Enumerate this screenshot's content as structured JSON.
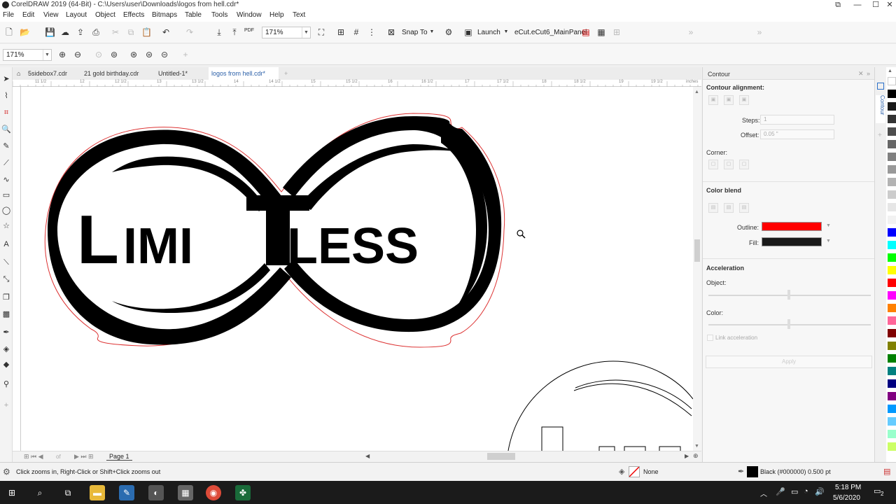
{
  "window": {
    "title": "CorelDRAW 2019 (64-Bit) - C:\\Users\\user\\Downloads\\logos from hell.cdr*"
  },
  "menu": [
    "File",
    "Edit",
    "View",
    "Layout",
    "Object",
    "Effects",
    "Bitmaps",
    "Table",
    "Tools",
    "Window",
    "Help",
    "Text"
  ],
  "toolbar": {
    "zoom_value": "171%",
    "snap_label": "Snap To",
    "launch_label": "Launch",
    "panel_label": "eCut.eCut6_MainPanel",
    "pdf_label": "PDF"
  },
  "property_bar": {
    "zoom_value": "171%"
  },
  "document_tabs": [
    "5sidebox7.cdr",
    "21 gold birthday.cdr",
    "Untitled-1*",
    "logos from hell.cdr*"
  ],
  "ruler": {
    "labels": [
      "11 1/2",
      "12",
      "12 1/2",
      "13",
      "13 1/2",
      "14",
      "14 1/2",
      "15",
      "15 1/2",
      "16",
      "16 1/2",
      "17",
      "17 1/2",
      "18",
      "18 1/2",
      "19",
      "19 1/2"
    ],
    "unit": "inches"
  },
  "canvas": {
    "logo_text": "LimiTless"
  },
  "page_nav": {
    "of_label": "of",
    "page_tab": "Page 1"
  },
  "contour_panel": {
    "title": "Contour",
    "alignment_label": "Contour alignment:",
    "steps_label": "Steps:",
    "steps_value": "1",
    "offset_label": "Offset:",
    "offset_value": "0.05 \"",
    "corner_label": "Corner:",
    "color_blend_label": "Color blend",
    "outline_label": "Outline:",
    "outline_color": "#ff0000",
    "fill_label": "Fill:",
    "fill_color": "#1a1a1a",
    "acceleration_label": "Acceleration",
    "object_label": "Object:",
    "color_label": "Color:",
    "link_label": "Link acceleration",
    "apply_label": "Apply",
    "side_tab": "Contour"
  },
  "palette_colors": [
    "#ffffff",
    "#000000",
    "#1a1a1a",
    "#333333",
    "#4d4d4d",
    "#666666",
    "#808080",
    "#999999",
    "#b3b3b3",
    "#cccccc",
    "#e6e6e6",
    "#f2f2f2",
    "#0000ff",
    "#00ffff",
    "#00ff00",
    "#ffff00",
    "#ff0000",
    "#ff00ff",
    "#ff8000",
    "#ff6699",
    "#800000",
    "#808000",
    "#008000",
    "#008080",
    "#000080",
    "#800080",
    "#0099ff",
    "#66ccff",
    "#99ffcc",
    "#ccff66"
  ],
  "status": {
    "hint": "Click zooms in, Right-Click or Shift+Click zooms out",
    "fill_none": "None",
    "outline_info": "Black (#000000)  0.500 pt"
  },
  "taskbar": {
    "time": "5:18 PM",
    "date": "5/6/2020",
    "notifications": "2"
  }
}
